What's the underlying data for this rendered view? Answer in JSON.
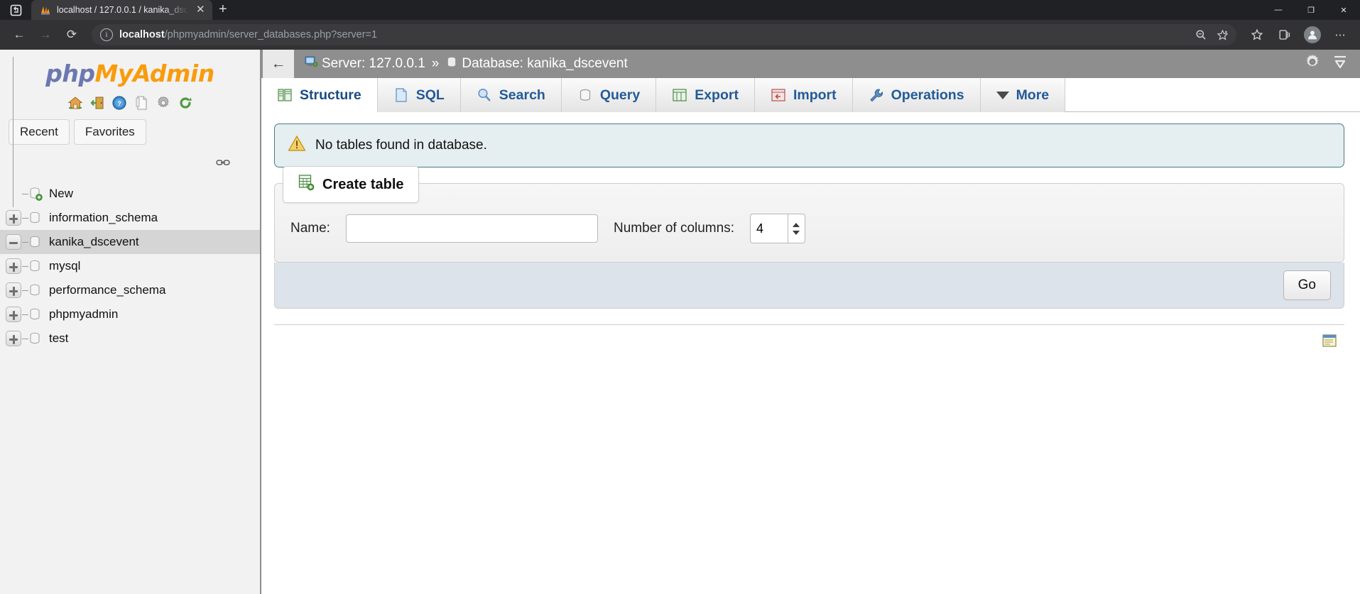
{
  "browser": {
    "tab": {
      "title": "localhost / 127.0.0.1 / kanika_dsc",
      "close_label": "✕",
      "favicon_name": "phpmyadmin-favicon"
    },
    "new_tab_label": "+",
    "window_controls": {
      "minimize": "—",
      "maximize": "❐",
      "close": "✕"
    },
    "nav": {
      "back": "←",
      "forward": "→",
      "reload": "⟳"
    },
    "url": {
      "host": "localhost",
      "path": "/phpmyadmin/server_databases.php?server=1"
    },
    "omnibox_icons": {
      "info": "i",
      "zoom": "🔍",
      "favorite_add": "☆"
    },
    "toolbar_icons": {
      "favorites": "☆",
      "collections": "⧉",
      "profile": "👤",
      "settings": "⋯"
    }
  },
  "sidebar": {
    "logo": {
      "php": "php",
      "myadmin": "MyAdmin"
    },
    "quick_icons": [
      {
        "name": "home-icon",
        "title": "Home"
      },
      {
        "name": "logout-icon",
        "title": "Log out"
      },
      {
        "name": "help-icon",
        "title": "phpMyAdmin documentation"
      },
      {
        "name": "docs-icon",
        "title": "Documentation"
      },
      {
        "name": "settings-gear-icon",
        "title": "Settings"
      },
      {
        "name": "refresh-icon",
        "title": "Reload navigation"
      }
    ],
    "tabs": [
      {
        "label": "Recent"
      },
      {
        "label": "Favorites"
      }
    ],
    "tree": [
      {
        "label": "New",
        "expander": "none",
        "icon": "db-new-icon",
        "selected": false
      },
      {
        "label": "information_schema",
        "expander": "plus",
        "icon": "db-icon",
        "selected": false
      },
      {
        "label": "kanika_dscevent",
        "expander": "minus",
        "icon": "db-icon",
        "selected": true
      },
      {
        "label": "mysql",
        "expander": "plus",
        "icon": "db-icon",
        "selected": false
      },
      {
        "label": "performance_schema",
        "expander": "plus",
        "icon": "db-icon",
        "selected": false
      },
      {
        "label": "phpmyadmin",
        "expander": "plus",
        "icon": "db-icon",
        "selected": false
      },
      {
        "label": "test",
        "expander": "plus",
        "icon": "db-icon",
        "selected": false
      }
    ]
  },
  "main": {
    "breadcrumb": {
      "back_arrow": "←",
      "server_label": "Server: 127.0.0.1",
      "separator": "»",
      "database_label": "Database: kanika_dscevent"
    },
    "tabs": [
      {
        "label": "Structure",
        "icon": "structure-icon",
        "active": true
      },
      {
        "label": "SQL",
        "icon": "sql-icon",
        "active": false
      },
      {
        "label": "Search",
        "icon": "search-icon",
        "active": false
      },
      {
        "label": "Query",
        "icon": "query-icon",
        "active": false
      },
      {
        "label": "Export",
        "icon": "export-icon",
        "active": false
      },
      {
        "label": "Import",
        "icon": "import-icon",
        "active": false
      },
      {
        "label": "Operations",
        "icon": "operations-wrench-icon",
        "active": false
      },
      {
        "label": "More",
        "icon": "chevron-down-icon",
        "active": false
      }
    ],
    "notice": {
      "text": "No tables found in database.",
      "icon": "warning-triangle-icon"
    },
    "create_table": {
      "legend": "Create table",
      "legend_icon": "create-table-icon",
      "name_label": "Name:",
      "name_value": "",
      "columns_label": "Number of columns:",
      "columns_value": "4",
      "go_label": "Go"
    }
  },
  "colors": {
    "accent_blue": "#235a97",
    "logo_php": "#6c78af",
    "logo_myadmin": "#f89c0e",
    "notice_bg": "#e5eef1",
    "notice_border": "#4a7c85",
    "serverbar_bg": "#8e8e8e",
    "footer_bg": "#dde3ea",
    "selected_row": "#d5d5d5"
  }
}
